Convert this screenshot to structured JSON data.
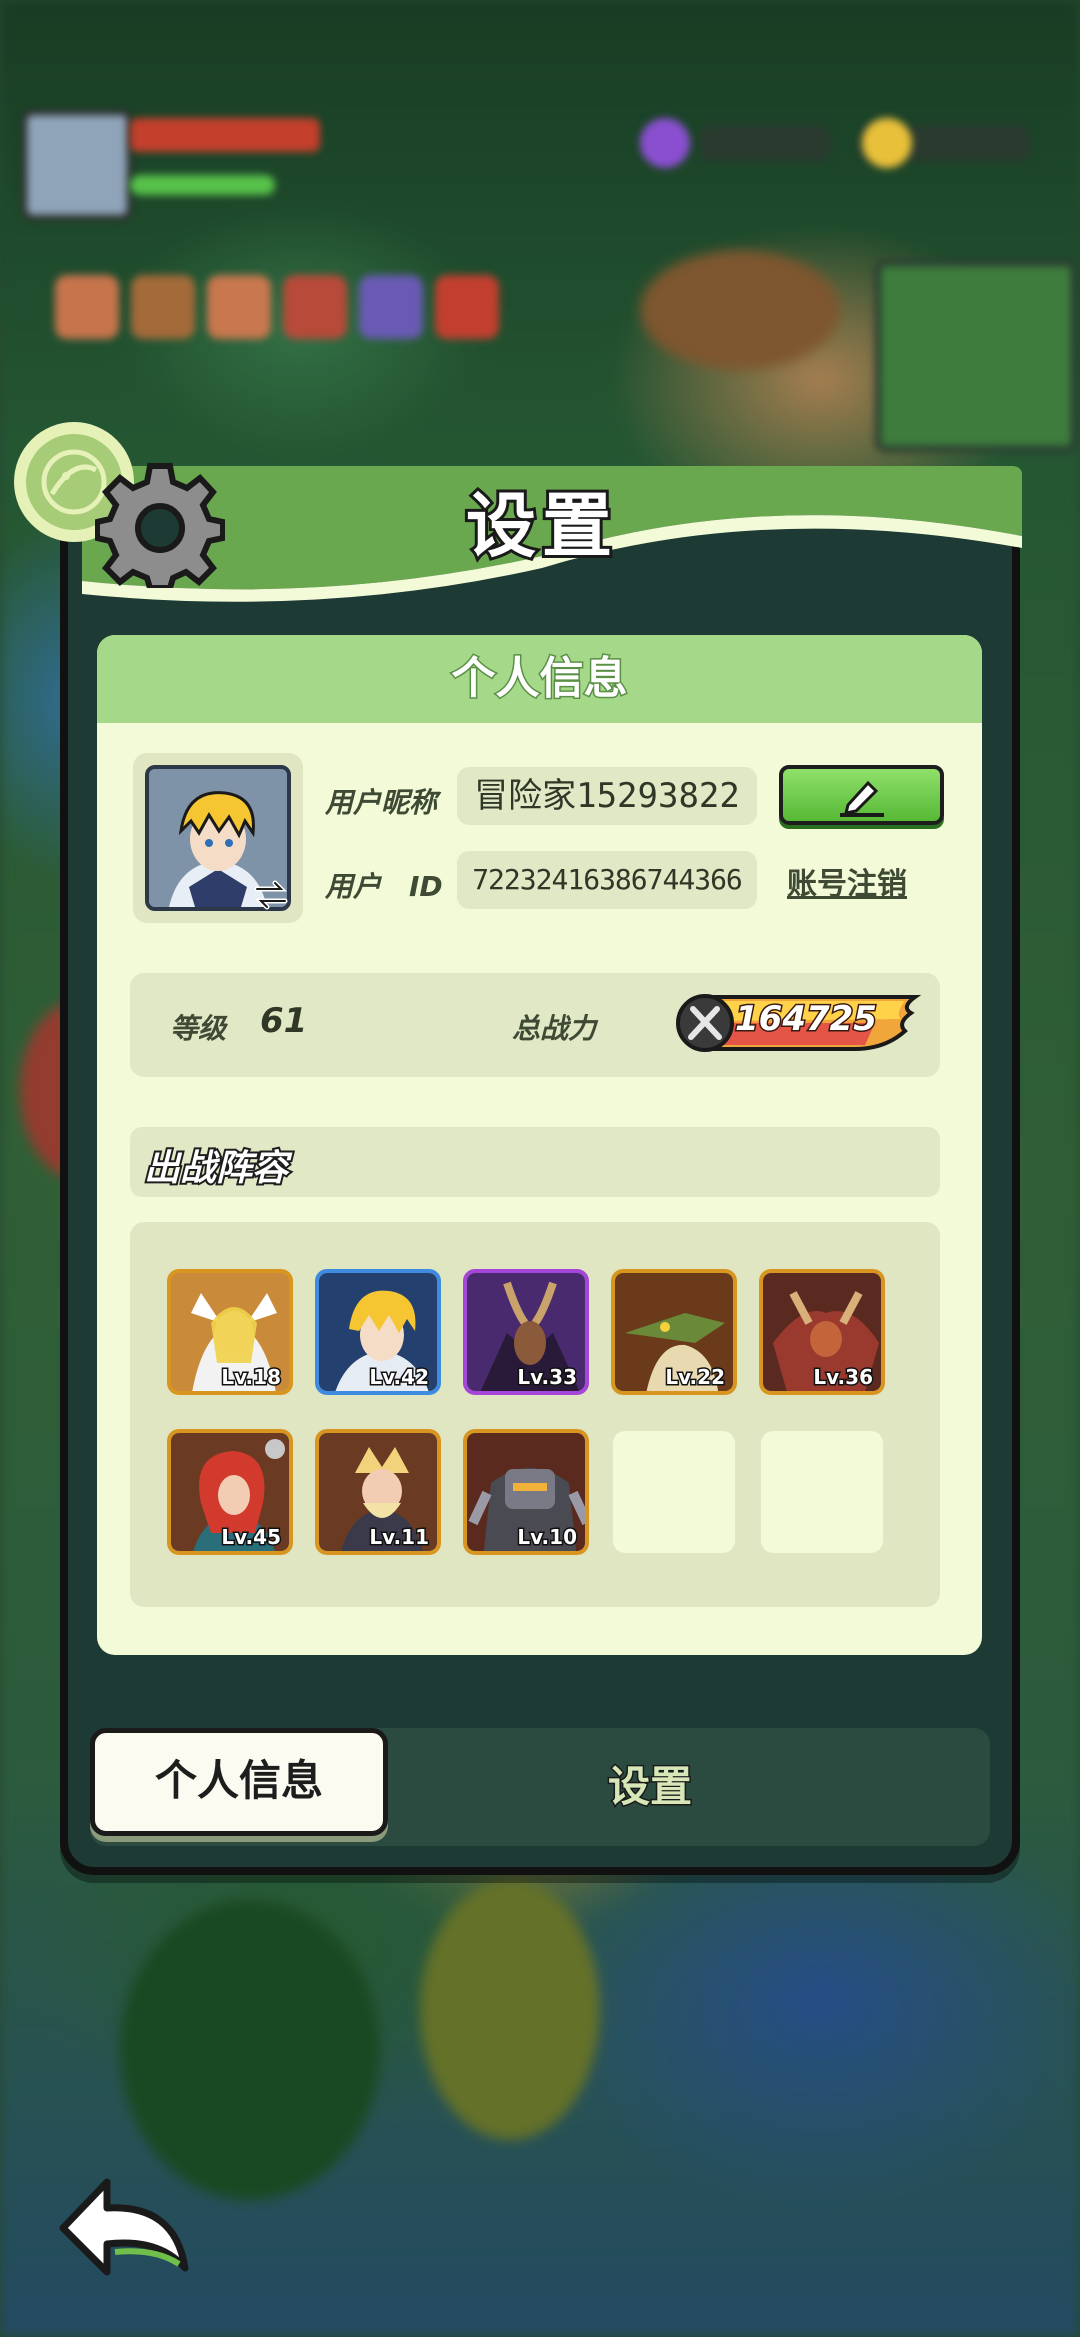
{
  "dialog": {
    "title": "设置"
  },
  "info_card": {
    "header": "个人信息",
    "nickname_label": "用户昵称",
    "nickname_value": "冒险家15293822",
    "id_label": "用户　ID",
    "id_value": "72232416386744366",
    "delete_account_label": "账号注销",
    "level_label": "等级",
    "level_value": "61",
    "power_label": "总战力",
    "power_value": "164725"
  },
  "lineup": {
    "title": "出战阵容",
    "heroes": [
      {
        "level": "Lv.18",
        "rarity": "orange"
      },
      {
        "level": "Lv.42",
        "rarity": "blue"
      },
      {
        "level": "Lv.33",
        "rarity": "purple"
      },
      {
        "level": "Lv.22",
        "rarity": "orange"
      },
      {
        "level": "Lv.36",
        "rarity": "orange"
      },
      {
        "level": "Lv.45",
        "rarity": "orange"
      },
      {
        "level": "Lv.11",
        "rarity": "orange"
      },
      {
        "level": "Lv.10",
        "rarity": "orange"
      }
    ],
    "empty_slots": 2
  },
  "tabs": [
    {
      "label": "个人信息",
      "active": true
    },
    {
      "label": "设置",
      "active": false
    }
  ],
  "colors": {
    "header_green": "#a6d889",
    "card_bg": "#f3fad8",
    "panel_bg": "#e1e8c5",
    "edit_button": "#57b936",
    "rarity_orange": "#d89620",
    "rarity_blue": "#3f8be0",
    "rarity_purple": "#a646d8"
  },
  "icons": [
    "gear-icon",
    "badge-icon",
    "pencil-icon",
    "sword-icon",
    "back-arrow-icon"
  ]
}
